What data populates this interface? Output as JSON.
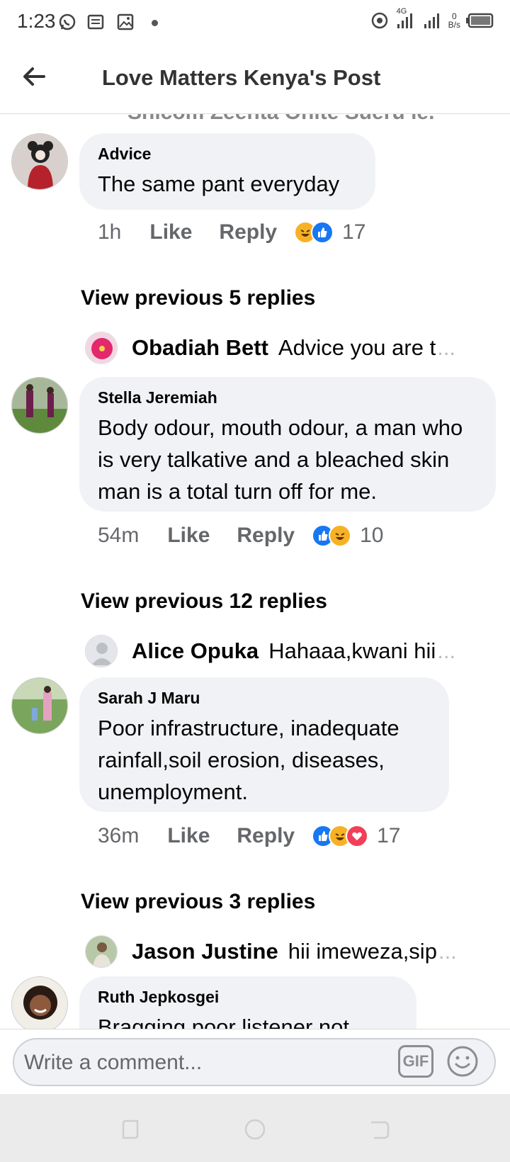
{
  "status_bar": {
    "time": "1:23",
    "network_type": "4G",
    "data_speed_value": "0",
    "data_speed_unit": "B/s"
  },
  "header": {
    "title": "Love Matters Kenya's Post"
  },
  "cutoff_text": "Shicom Zeenta  Onite Sueru le.",
  "comments": [
    {
      "author": "Advice",
      "text": "The same pant everyday",
      "time": "1h",
      "like_label": "Like",
      "reply_label": "Reply",
      "reactions": [
        "haha",
        "like"
      ],
      "reaction_count": "17",
      "view_previous": "View previous 5 replies",
      "reply_preview": {
        "name": "Obadiah Bett",
        "text": "Advice you are t",
        "ellipsis": "..."
      }
    },
    {
      "author": "Stella Jeremiah",
      "text": "Body odour, mouth odour, a man who is very talkative and a bleached skin man is a total turn off for me.",
      "time": "54m",
      "like_label": "Like",
      "reply_label": "Reply",
      "reactions": [
        "like",
        "haha"
      ],
      "reaction_count": "10",
      "view_previous": "View previous 12 replies",
      "reply_preview": {
        "name": "Alice Opuka",
        "text": "Hahaaa,kwani hii ",
        "ellipsis": "..."
      }
    },
    {
      "author": "Sarah J Maru",
      "text": "Poor infrastructure, inadequate rainfall,soil erosion, diseases, unemployment.",
      "time": "36m",
      "like_label": "Like",
      "reply_label": "Reply",
      "reactions": [
        "like",
        "haha",
        "love"
      ],
      "reaction_count": "17",
      "view_previous": "View previous 3 replies",
      "reply_preview": {
        "name": "Jason Justine",
        "text": "hii imeweza,sip",
        "ellipsis": "..."
      }
    },
    {
      "author": "Ruth Jepkosgei",
      "text": "Bragging poor listener not"
    }
  ],
  "composer": {
    "placeholder": "Write a comment...",
    "gif_label": "GIF"
  },
  "colors": {
    "bubble": "#f0f2f5",
    "secondary_text": "#65676b",
    "like_blue": "#1877f2",
    "haha_yellow": "#f7b125",
    "love_red": "#f33e58"
  }
}
